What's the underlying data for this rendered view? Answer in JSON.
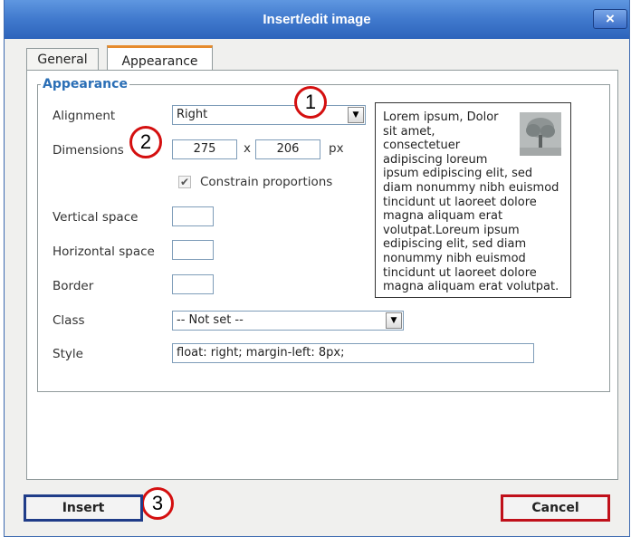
{
  "window": {
    "title": "Insert/edit image",
    "close_label": "×"
  },
  "tabs": [
    {
      "label": "General"
    },
    {
      "label": "Appearance"
    }
  ],
  "fieldset": {
    "legend": "Appearance"
  },
  "form": {
    "alignment": {
      "label": "Alignment",
      "value": "Right"
    },
    "dimensions": {
      "label": "Dimensions",
      "width": "275",
      "separator": "x",
      "height": "206",
      "unit": "px"
    },
    "constrain": {
      "label": "Constrain proportions",
      "checked": true
    },
    "vertical_space": {
      "label": "Vertical space",
      "value": ""
    },
    "horizontal_space": {
      "label": "Horizontal space",
      "value": ""
    },
    "border": {
      "label": "Border",
      "value": ""
    },
    "class": {
      "label": "Class",
      "value": "-- Not set --"
    },
    "style": {
      "label": "Style",
      "value": "float: right; margin-left: 8px;"
    }
  },
  "preview": {
    "text": "Lorem ipsum, Dolor sit amet, consectetuer adipiscing loreum ipsum edipiscing elit, sed diam nonummy nibh euismod tincidunt ut laoreet dolore magna aliquam erat volutpat.Loreum ipsum edipiscing elit, sed diam nonummy nibh euismod tincidunt ut laoreet dolore magna aliquam erat volutpat."
  },
  "callouts": [
    "1",
    "2",
    "3"
  ],
  "buttons": {
    "insert": "Insert",
    "cancel": "Cancel"
  },
  "colors": {
    "title_bar": "#4079cd",
    "legend": "#2b6fb6",
    "callout_border": "#d40f0f",
    "cancel_border": "#c0101a",
    "active_tab": "#e68b2c"
  }
}
